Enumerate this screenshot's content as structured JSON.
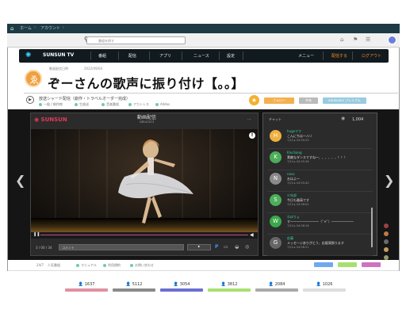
{
  "browser": {
    "home_icon": "home-icon",
    "crumbs": [
      "ホーム",
      "アカウント"
    ]
  },
  "toolbar": {
    "search_placeholder": "番組を探す"
  },
  "nav": {
    "brand": "SUNSUN  TV",
    "items": [
      "番組",
      "配信",
      "アプリ",
      "ニュース",
      "設定"
    ],
    "menu": "メニュー",
    "start": "配信する",
    "logout": "ログアウト"
  },
  "subcrumb": [
    "動画配信日時",
    "2022/09/04"
  ],
  "page_title": "ぞーさんの歌声に振り付け【。。】",
  "meta": {
    "title": "放送シャード配信（劇作・トラベルオーダー完成）",
    "tags": [
      "一般 / 制作物",
      "生放送",
      "音楽番組",
      "アカトレス",
      "Alldas"
    ]
  },
  "actions": {
    "follow": "フォロー",
    "share": "共有",
    "premium": "announce プレミアム"
  },
  "player": {
    "label": "SUNSUN",
    "title": "動画配信",
    "subtitle": "sakura13",
    "time": "3 / 00 / 34",
    "comment_placeholder": "コメント",
    "send": "⯈"
  },
  "chat": {
    "header": "チャット",
    "count": "1,004",
    "messages": [
      {
        "initial": "H",
        "name": "hugoママ",
        "text": "こんにちは～♪♪♪",
        "time": "7/24 ▸ 04:55:20",
        "color": "#f0b040"
      },
      {
        "initial": "K",
        "name": "Kinchang",
        "text": "素敵なダンスですね～、、、、、、！！！",
        "time": "7/24 ▸ 04:55:36",
        "color": "#4cae5a"
      },
      {
        "initial": "N",
        "name": "naco",
        "text": "おはよ～",
        "time": "7/24 ▸ 04:55:40",
        "color": "#8a8a8a"
      },
      {
        "initial": "S",
        "name": "少年部",
        "text": "今日も最高です",
        "time": "7/24 ▸ 04:56:02",
        "color": "#4cae5a"
      },
      {
        "initial": "W",
        "name": "わぽりょ",
        "text": "す～～～～～～～～～（ﾟ∀ﾟ）～～～～～～～",
        "time": "7/24 ▸ 04:56:16",
        "color": "#3aa84a"
      },
      {
        "initial": "G",
        "name": "佐藤",
        "text": "メッセージありがとう、応援頑張ります",
        "time": "7/24 ▸ 04:56:21",
        "color": "#666666"
      }
    ]
  },
  "side_dots": [
    "#a04040",
    "#c07a4a",
    "#6a6a6a",
    "#c0a060",
    "#9a9a70"
  ],
  "bottom": {
    "left": [
      "24/7",
      "人気番組",
      "マニュアル",
      "利用規約",
      "お問い合わせ"
    ],
    "buttons": [
      "#70a8f0",
      "#a8e070",
      "#d070c0"
    ]
  },
  "footer_stats": [
    {
      "value": "1637",
      "color": "#e090a0"
    },
    {
      "value": "5112",
      "color": "#8a8a8a"
    },
    {
      "value": "3054",
      "color": "#6a70d0"
    },
    {
      "value": "3812",
      "color": "#a8e070"
    },
    {
      "value": "2084",
      "color": "#aaaaaa"
    },
    {
      "value": "1026",
      "color": "#dddddd"
    }
  ]
}
